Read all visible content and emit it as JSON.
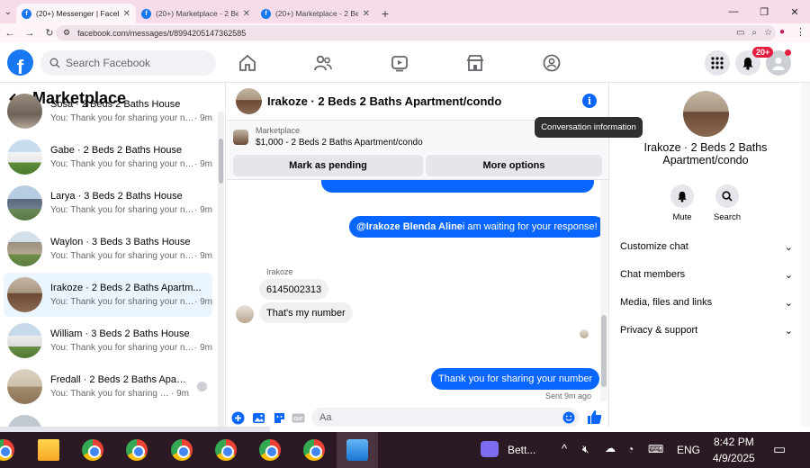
{
  "browser": {
    "tabs": [
      {
        "title": "(20+) Messenger | Facebook",
        "active": true
      },
      {
        "title": "(20+) Marketplace - 2 Beds 2 Ba",
        "active": false
      },
      {
        "title": "(20+) Marketplace - 2 Beds 2 Ba",
        "active": false
      }
    ],
    "url": "facebook.com/messages/t/8994205147362585"
  },
  "fb_nav": {
    "search_placeholder": "Search Facebook",
    "notification_badge": "20+"
  },
  "left_panel": {
    "title": "Marketplace",
    "conversations": [
      {
        "name": "Sosa · 2 Beds 2 Baths House",
        "preview": "You: Thank you for sharing your nu...",
        "time": "· 9m",
        "thumb": "interior"
      },
      {
        "name": "Gabe · 2 Beds 2 Baths House",
        "preview": "You: Thank you for sharing your nu...",
        "time": "· 9m",
        "thumb": "house-white"
      },
      {
        "name": "Larya · 3 Beds 2 Baths House",
        "preview": "You: Thank you for sharing your nu...",
        "time": "· 9m",
        "thumb": "house-gray"
      },
      {
        "name": "Waylon · 3 Beds 3 Baths House",
        "preview": "You: Thank you for sharing your nu...",
        "time": "· 9m",
        "thumb": "house-stone"
      },
      {
        "name": "Irakoze · 2 Beds 2 Baths Apartm...",
        "preview": "You: Thank you for sharing your nu...",
        "time": "· 9m",
        "thumb": "interior",
        "selected": true
      },
      {
        "name": "William · 3 Beds 2 Baths House",
        "preview": "You: Thank you for sharing your nu...",
        "time": "· 9m",
        "thumb": "house-white"
      },
      {
        "name": "Fredall · 2 Beds 2 Baths Apart...",
        "preview": "You: Thank you for sharing your nu...",
        "time": "· 9m",
        "thumb": "interior-light",
        "seen": true
      }
    ]
  },
  "chat": {
    "title": "Irakoze · 2 Beds 2 Baths Apartment/condo",
    "tooltip": "Conversation information",
    "marketplace_label": "Marketplace",
    "listing": "$1,000 - 2 Beds 2 Baths Apartment/condo",
    "mark_pending": "Mark as pending",
    "more_options": "More options",
    "mention": "@Irakoze Blenda Aline",
    "mention_rest": " i am waiting for your response!",
    "sender_name": "Irakoze",
    "msg_phone": "6145002313",
    "msg_number": "That's my number",
    "msg_thanks": "Thank you for sharing your number",
    "sent_status": "Sent 9m ago",
    "composer_placeholder": "Aa"
  },
  "info_panel": {
    "title": "Irakoze · 2 Beds 2 Baths Apartment/condo",
    "mute": "Mute",
    "search": "Search",
    "rows": [
      "Customize chat",
      "Chat members",
      "Media, files and links",
      "Privacy & support"
    ]
  },
  "taskbar": {
    "app_label": "Bett...",
    "lang": "ENG",
    "time": "8:42 PM",
    "date": "4/9/2025"
  },
  "colors": {
    "fb_blue": "#1877f2",
    "messenger_blue": "#0866ff",
    "badge_red": "#e41e3f"
  }
}
